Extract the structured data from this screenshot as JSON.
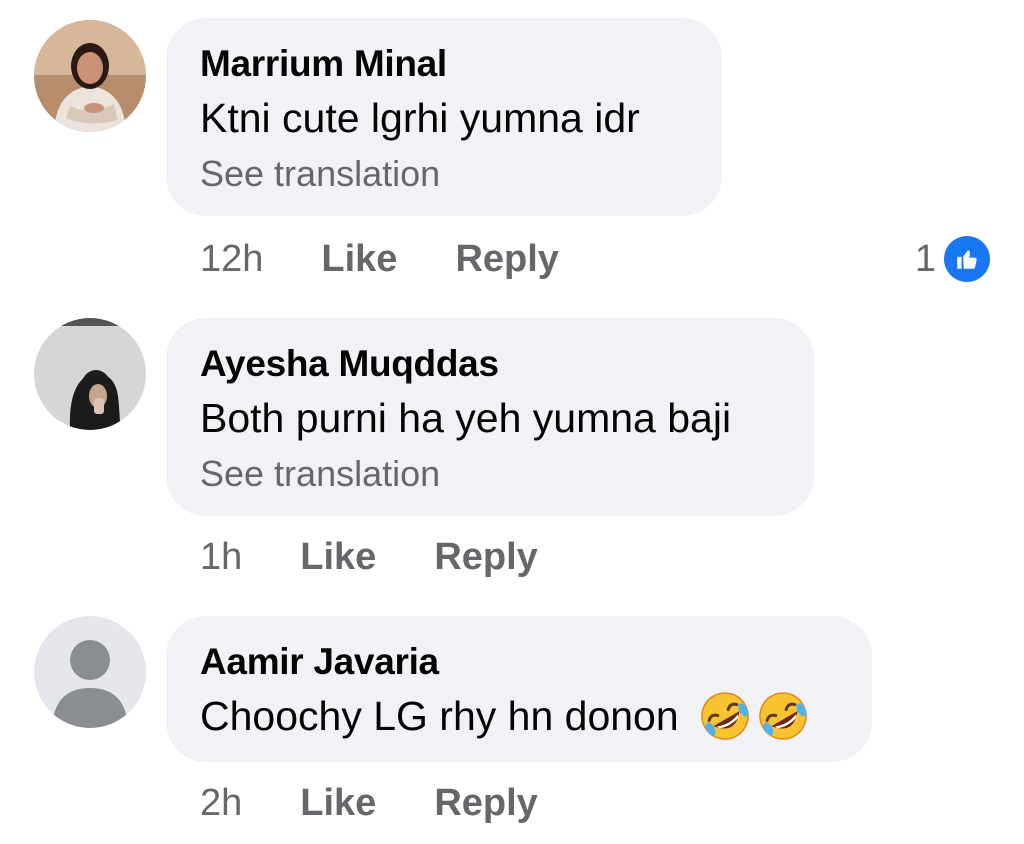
{
  "comments": [
    {
      "author": "Marrium Minal",
      "text": "Ktni cute lgrhi yumna idr",
      "translation_link": "See translation",
      "time": "12h",
      "like_label": "Like",
      "reply_label": "Reply",
      "reaction_count": "1",
      "reaction_icon": "like-reaction-icon"
    },
    {
      "author": "Ayesha Muqddas",
      "text": "Both purni ha yeh yumna baji",
      "translation_link": "See translation",
      "time": "1h",
      "like_label": "Like",
      "reply_label": "Reply"
    },
    {
      "author": "Aamir Javaria",
      "text": "Choochy LG rhy hn donon",
      "emojis": [
        "rolling-on-floor-laughing-emoji",
        "rolling-on-floor-laughing-emoji"
      ],
      "time": "2h",
      "like_label": "Like",
      "reply_label": "Reply"
    }
  ],
  "colors": {
    "bubble_bg": "#f0f2f5",
    "secondary_text": "#65676b",
    "like_blue": "#1877f2"
  }
}
